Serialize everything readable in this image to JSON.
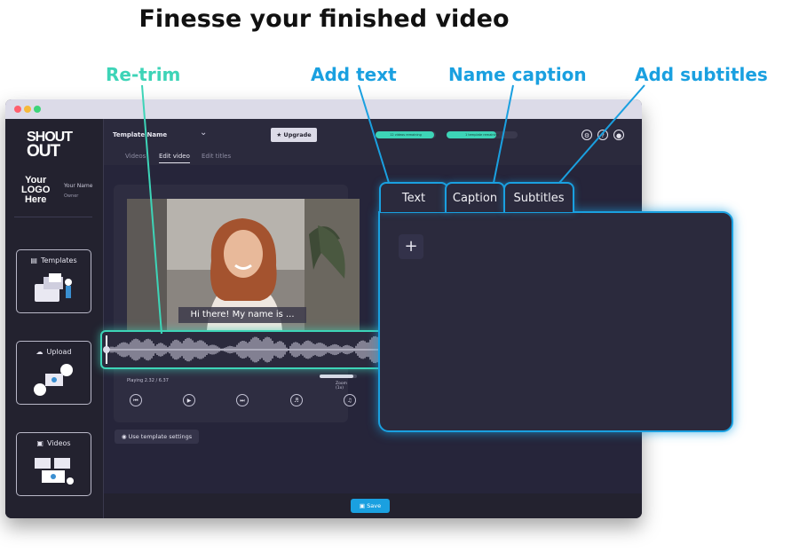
{
  "headline": "Finesse your finished video",
  "callouts": {
    "retrim": "Re-trim",
    "add_text": "Add text",
    "name_caption": "Name caption",
    "add_subtitles": "Add subtitles"
  },
  "colors": {
    "teal": "#3dd4b7",
    "blue": "#1aa0e0",
    "window_bg": "#2b2a3d",
    "sidebar_bg": "#23222f",
    "dot_red": "#ff5f6d",
    "dot_yellow": "#f6b93b",
    "dot_green": "#3dd47a"
  },
  "sidebar": {
    "brand_line1": "SHOUT",
    "brand_line2": "OUT",
    "user_logo_line1": "Your",
    "user_logo_line2": "LOGO",
    "user_logo_line3": "Here",
    "user_name": "Your Name",
    "user_role": "Owner",
    "items": [
      {
        "label": "Templates",
        "icon": "document-icon"
      },
      {
        "label": "Upload",
        "icon": "cloud-upload-icon"
      },
      {
        "label": "Videos",
        "icon": "lock-icon"
      }
    ]
  },
  "header": {
    "template_name": "Template Name",
    "upgrade_label": "Upgrade",
    "pill1_text": "12 videos remaining",
    "pill2_text": "1 template remaining",
    "tabs": [
      "Videos",
      "Edit video",
      "Edit titles"
    ],
    "active_tab": "Edit video"
  },
  "video": {
    "caption_text": "Hi there! My name is ...",
    "playing_text": "Playing 2.32 / 6.37",
    "zoom_label": "Zoom (1x)",
    "zoom_level": 0.9
  },
  "use_template_label": "Use template settings",
  "save_label": "Save",
  "panel_tabs": [
    "Text",
    "Caption",
    "Subtitles"
  ],
  "panel_add_glyph": "+"
}
